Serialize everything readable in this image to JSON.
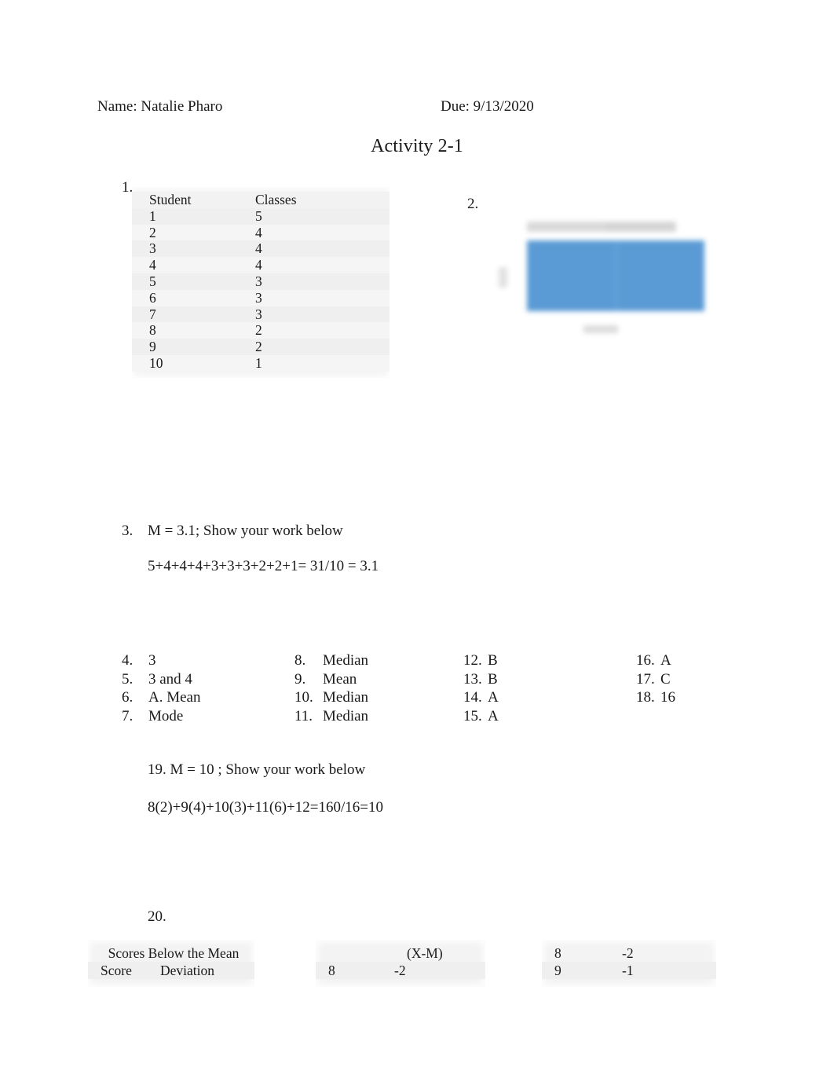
{
  "header": {
    "name_line": "Name: Natalie Pharo",
    "due_line": "Due: 9/13/2020",
    "title": "Activity 2-1"
  },
  "item1": {
    "number": "1.",
    "columns": [
      "Student",
      "Classes"
    ],
    "rows": [
      [
        "1",
        "5"
      ],
      [
        "2",
        "4"
      ],
      [
        "3",
        "4"
      ],
      [
        "4",
        "4"
      ],
      [
        "5",
        "3"
      ],
      [
        "6",
        "3"
      ],
      [
        "7",
        "3"
      ],
      [
        "8",
        "2"
      ],
      [
        "9",
        "2"
      ],
      [
        "10",
        "1"
      ]
    ]
  },
  "item2": {
    "number": "2.",
    "description": "embedded bar chart image, blurred and illegible",
    "bar_color": "#5b9bd5"
  },
  "item3": {
    "number": "3.",
    "answer": "M = 3.1; Show your work below",
    "work": "5+4+4+4+3+3+3+2+2+1= 31/10 = 3.1"
  },
  "answers": {
    "col1": [
      {
        "num": "4.",
        "value": "3"
      },
      {
        "num": "5.",
        "value": "3 and 4"
      },
      {
        "num": "6.",
        "value": "A. Mean"
      },
      {
        "num": "7.",
        "value": "Mode"
      }
    ],
    "col2": [
      {
        "num": "8.",
        "value": "Median"
      },
      {
        "num": "9.",
        "value": "Mean"
      },
      {
        "num": "10.",
        "value": "Median"
      },
      {
        "num": "11.",
        "value": "Median"
      }
    ],
    "col3": [
      {
        "num": "12.",
        "value": "B"
      },
      {
        "num": "13.",
        "value": "B"
      },
      {
        "num": "14.",
        "value": "A"
      },
      {
        "num": "15.",
        "value": "A"
      }
    ],
    "col4": [
      {
        "num": "16.",
        "value": "A"
      },
      {
        "num": "17.",
        "value": "C"
      },
      {
        "num": "18.",
        "value": "16"
      }
    ]
  },
  "item19": {
    "answer": "19. M = 10 ; Show your work below",
    "work": "8(2)+9(4)+10(3)+11(6)+12=160/16=10"
  },
  "item20": {
    "number": "20.",
    "table_a": {
      "span_header": "Scores Below the Mean",
      "columns": [
        "Score",
        "Deviation"
      ]
    },
    "table_b": {
      "header_left": "",
      "header_right": "(X-M)",
      "rows": [
        [
          "8",
          "-2"
        ]
      ]
    },
    "table_c": {
      "rows": [
        [
          "8",
          "-2"
        ],
        [
          "9",
          "-1"
        ]
      ]
    }
  }
}
